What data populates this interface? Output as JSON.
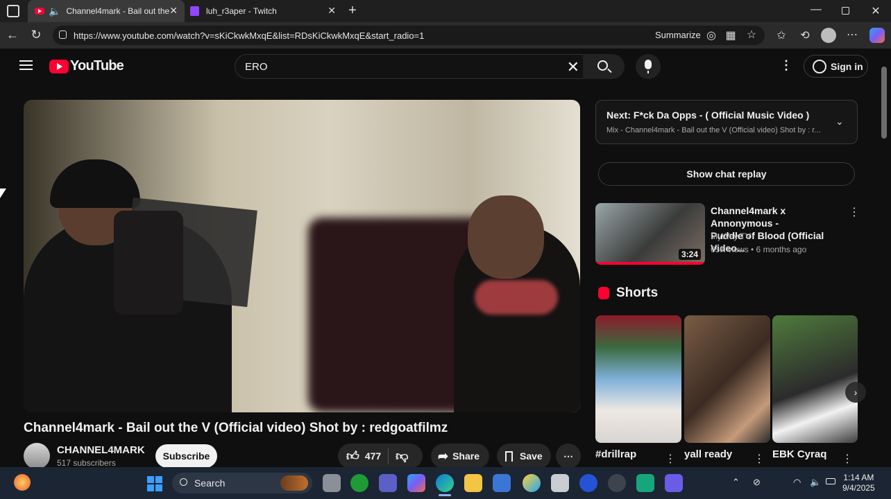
{
  "browser": {
    "tabs": [
      {
        "title": "Channel4mark - Bail out the",
        "active": true
      },
      {
        "title": "luh_r3aper - Twitch",
        "active": false
      }
    ],
    "url": "https://www.youtube.com/watch?v=sKiCkwkMxqE&list=RDsKiCkwkMxqE&start_radio=1",
    "summarize_label": "Summarize"
  },
  "youtube": {
    "logo_text": "YouTube",
    "search_value": "ERO",
    "sign_in_label": "Sign in",
    "video": {
      "title": "Channel4mark - Bail out the V (Official video) Shot by : redgoatfilmz",
      "channel_name": "CHANNEL4MARK",
      "subscribers": "517 subscribers",
      "subscribe_label": "Subscribe",
      "likes": "477",
      "share_label": "Share",
      "save_label": "Save"
    },
    "next": {
      "prefix": "Next:",
      "title": "F*ck Da Opps - ( Official Music Video )",
      "subtitle": "Mix - Channel4mark - Bail out the V (Official video) Shot by : r..."
    },
    "chat_replay_label": "Show chat replay",
    "recommended": {
      "title_line1": "Channel4mark x Annonymous -",
      "title_line2": "Puddle of Blood (Official Video...",
      "channel": "MyWay TV",
      "meta": "65K views • 6 months ago",
      "duration": "3:24"
    },
    "shorts_heading": "Shorts",
    "shorts": [
      {
        "label": "#drillrap"
      },
      {
        "label": "yall ready"
      },
      {
        "label": "EBK Cyraq"
      }
    ]
  },
  "taskbar": {
    "search_label": "Search",
    "time": "1:14 AM",
    "date": "9/4/2025"
  },
  "colors": {
    "accent": "#ff0033",
    "background": "#0f0f0f",
    "taskbar": "#1c2533"
  }
}
